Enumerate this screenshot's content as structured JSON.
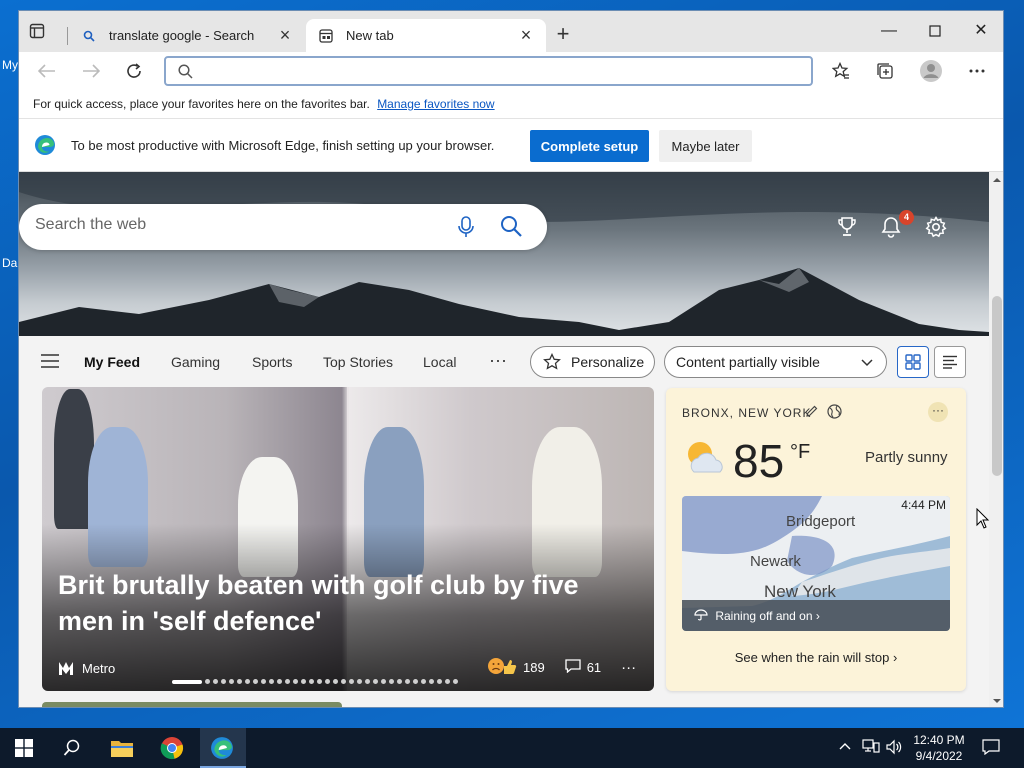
{
  "desktop": {
    "labels": [
      "My",
      "Da"
    ]
  },
  "browser": {
    "tabs": [
      {
        "title": "translate google - Search",
        "icon": "search-icon"
      },
      {
        "title": "New tab",
        "icon": "newtab-page-icon",
        "active": true
      }
    ],
    "address": {
      "value": "",
      "placeholder": ""
    },
    "favorites_bar": {
      "text": "For quick access, place your favorites here on the favorites bar.",
      "link": "Manage favorites now"
    },
    "setup_banner": {
      "text": "To be most productive with Microsoft Edge, finish setting up your browser.",
      "primary": "Complete setup",
      "secondary": "Maybe later"
    }
  },
  "ntp": {
    "search_placeholder": "Search the web",
    "notification_count": "4",
    "feed_tabs": [
      "My Feed",
      "Gaming",
      "Sports",
      "Top Stories",
      "Local"
    ],
    "personalize": "Personalize",
    "content_mode": "Content partially visible",
    "hero_story": {
      "headline": "Brit brutally beaten with golf club by five men in 'self defence'",
      "source": "Metro",
      "reactions": "189",
      "comments": "61"
    },
    "weather": {
      "location": "BRONX, NEW YORK",
      "temp": "85",
      "unit": "°F",
      "condition": "Partly sunny",
      "map_time": "4:44 PM",
      "map_labels": [
        "Bridgeport",
        "Newark",
        "New York"
      ],
      "map_note": "Raining off and on ›",
      "link": "See when the rain will stop ›"
    }
  },
  "taskbar": {
    "time": "12:40 PM",
    "date": "9/4/2022"
  },
  "colors": {
    "accent": "#0a6ccf",
    "badge": "#d9442b",
    "weather_card": "#fcf3d9"
  }
}
